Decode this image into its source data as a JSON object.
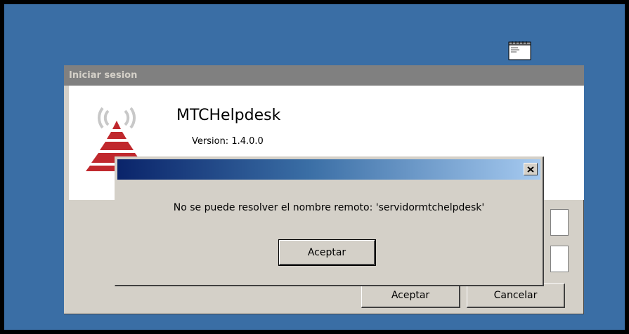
{
  "login_window": {
    "title": "Iniciar sesion",
    "app_name": "MTCHelpdesk",
    "version": "Version: 1.4.0.0",
    "ok_label": "Aceptar",
    "cancel_label": "Cancelar"
  },
  "error_dialog": {
    "title": "",
    "message": "No se puede resolver el nombre remoto: 'servidormtchelpdesk'",
    "ok_label": "Aceptar"
  },
  "icons": {
    "desktop": "notepad-icon",
    "logo": "signal-pyramid-logo",
    "close": "close-icon"
  },
  "colors": {
    "desktop_background": "#3a6ea5",
    "window_face": "#d4d0c8",
    "inactive_title": "#808080",
    "active_title_start": "#0a246a",
    "active_title_end": "#a6caf0",
    "logo_red": "#c0282d"
  }
}
